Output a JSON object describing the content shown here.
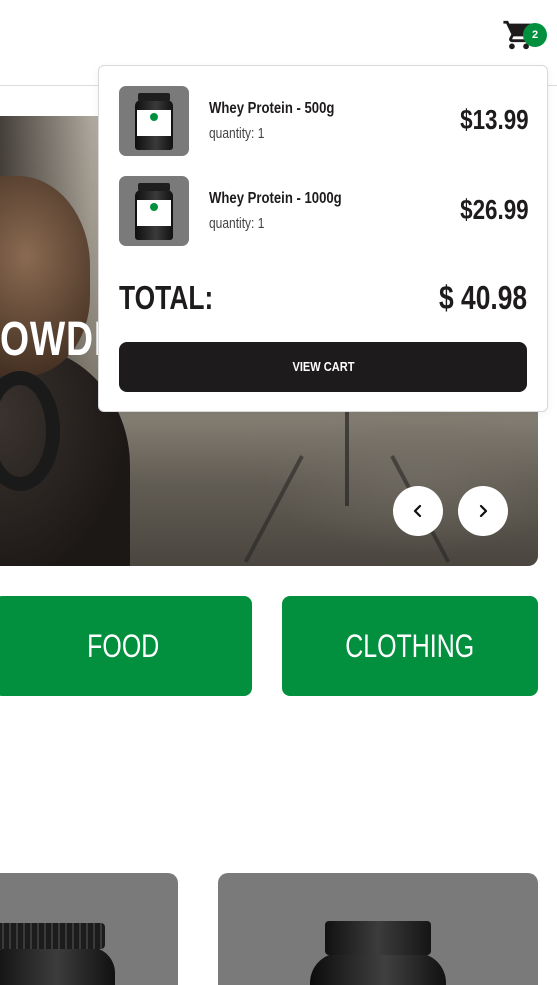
{
  "header": {
    "cart_count": "2"
  },
  "hero": {
    "title_fragment": "OWDE"
  },
  "categories": [
    {
      "label": "FOOD"
    },
    {
      "label": "CLOTHING"
    }
  ],
  "cart": {
    "items": [
      {
        "name": "Whey Protein - 500g",
        "quantity": "quantity: 1",
        "price": "$13.99"
      },
      {
        "name": "Whey Protein - 1000g",
        "quantity": "quantity: 1",
        "price": "$26.99"
      }
    ],
    "total_label": "TOTAL:",
    "total_value": "$ 40.98",
    "view_cart_label": "VIEW CART"
  },
  "colors": {
    "accent": "#02903e",
    "dark": "#1e1b1c",
    "card_bg": "#7a7a7a"
  },
  "icons": [
    "cart-icon",
    "chevron-left-icon",
    "chevron-right-icon"
  ]
}
